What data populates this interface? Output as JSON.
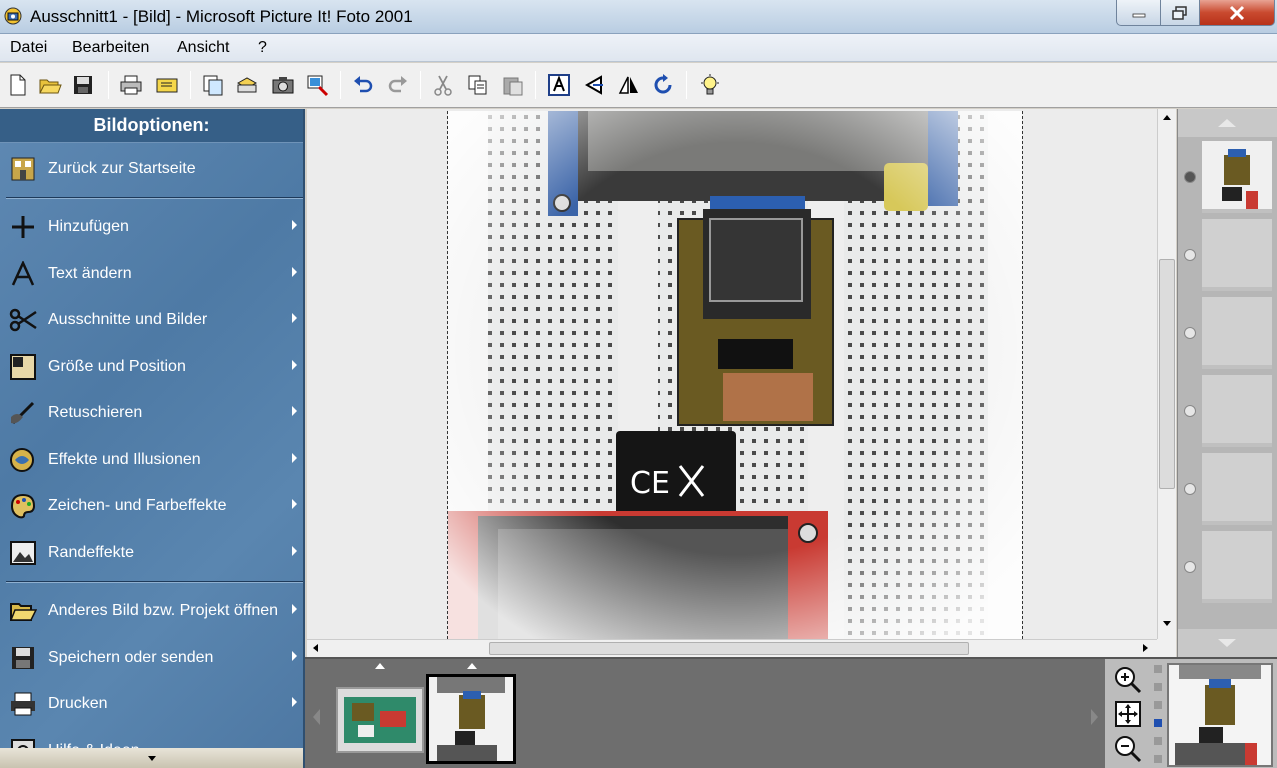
{
  "window": {
    "title": "Ausschnitt1 - [Bild] - Microsoft Picture It! Foto 2001"
  },
  "menu": {
    "items": [
      "Datei",
      "Bearbeiten",
      "Ansicht",
      "?"
    ]
  },
  "toolbar": {
    "buttons": [
      "new-icon",
      "open-icon",
      "save-icon",
      "print-icon",
      "card-icon",
      "copy-page-icon",
      "scan-icon",
      "camera-icon",
      "crop-tool-icon",
      "undo-icon",
      "redo-icon",
      "cut-icon",
      "copy-icon",
      "paste-icon",
      "text-frame-icon",
      "zoom-scale-icon",
      "flip-icon",
      "rotate-icon",
      "hint-icon"
    ]
  },
  "sidebar": {
    "heading": "Bildoptionen:",
    "home": "Zurück zur Startseite",
    "items": [
      {
        "label": "Hinzufügen",
        "icon": "plus-icon"
      },
      {
        "label": "Text ändern",
        "icon": "text-icon"
      },
      {
        "label": "Ausschnitte und Bilder",
        "icon": "scissors-icon"
      },
      {
        "label": "Größe und Position",
        "icon": "resize-icon"
      },
      {
        "label": "Retuschieren",
        "icon": "retouch-icon"
      },
      {
        "label": "Effekte und Illusionen",
        "icon": "effects-icon"
      },
      {
        "label": "Zeichen- und Farbeffekte",
        "icon": "paint-icon"
      },
      {
        "label": "Randeffekte",
        "icon": "border-icon"
      }
    ],
    "bottom_items": [
      {
        "label": "Anderes Bild bzw. Projekt öffnen",
        "icon": "folder-icon"
      },
      {
        "label": "Speichern oder senden",
        "icon": "save-icon"
      },
      {
        "label": "Drucken",
        "icon": "print-icon"
      },
      {
        "label": "Hilfe & Ideen",
        "icon": "help-icon"
      }
    ]
  },
  "canvas": {
    "image_caption": "breadboard with ESP32 module, SD card and displays"
  },
  "filmstrip": {
    "thumbnails": [
      "thumb-board",
      "thumb-crop"
    ],
    "active_index": 1
  },
  "colors": {
    "sidebar": "#4e7aa5",
    "sidebar_header": "#365f87",
    "close_button": "#c94a2f"
  }
}
